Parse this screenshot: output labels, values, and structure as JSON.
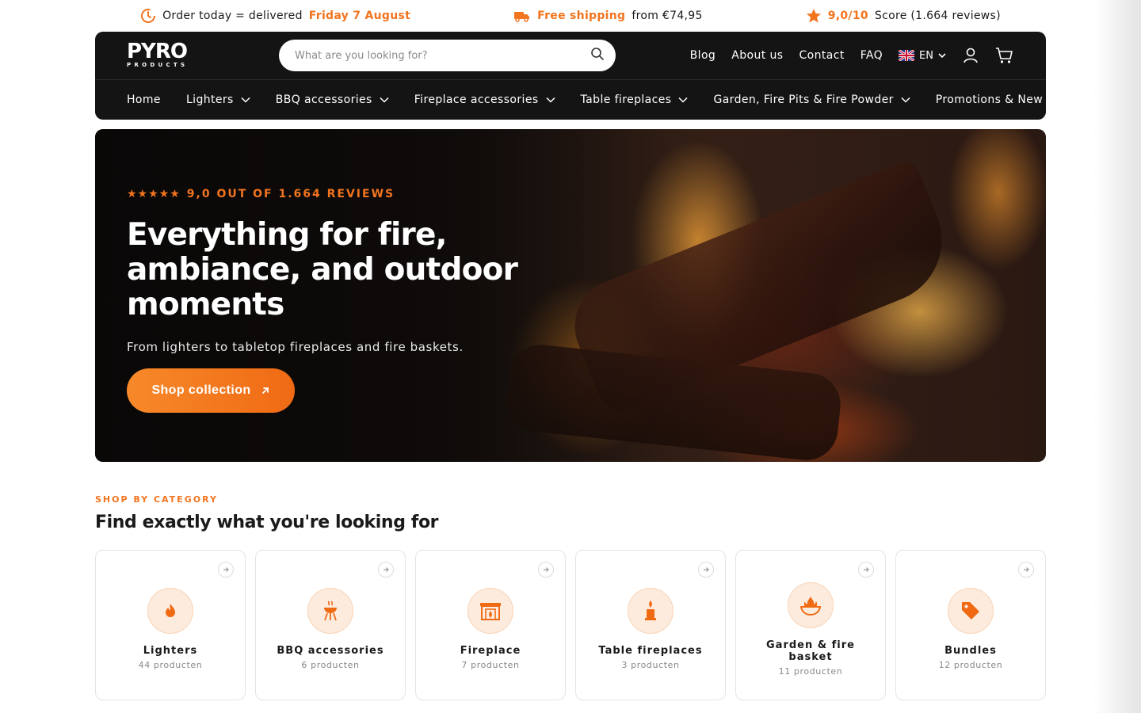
{
  "announcement": {
    "delivery_prefix": "Order today = delivered",
    "delivery_date": "Friday 7 August",
    "shipping_highlight": "Free shipping",
    "shipping_rest": "from €74,95",
    "score_highlight": "9,0/10",
    "score_rest": "Score (1.664 reviews)"
  },
  "header": {
    "logo_main": "PYRO",
    "logo_sub": "PRODUCTS",
    "search_placeholder": "What are you looking for?",
    "links": [
      "Blog",
      "About us",
      "Contact",
      "FAQ"
    ],
    "language": "EN",
    "nav": [
      {
        "label": "Home",
        "dropdown": false
      },
      {
        "label": "Lighters",
        "dropdown": true
      },
      {
        "label": "BBQ accessories",
        "dropdown": true
      },
      {
        "label": "Fireplace accessories",
        "dropdown": true
      },
      {
        "label": "Table fireplaces",
        "dropdown": true
      },
      {
        "label": "Garden, Fire Pits & Fire Powder",
        "dropdown": true
      },
      {
        "label": "Promotions & New Arrivals",
        "dropdown": false
      }
    ]
  },
  "hero": {
    "rating": "9,0 OUT OF 1.664 REVIEWS",
    "stars": "★★★★★",
    "title": "Everything for fire, ambiance, and outdoor moments",
    "subtitle": "From lighters to tabletop fireplaces and fire baskets.",
    "cta": "Shop collection"
  },
  "categories": {
    "eyebrow": "SHOP BY CATEGORY",
    "title": "Find exactly what you're looking for",
    "items": [
      {
        "name": "Lighters",
        "count": "44 producten",
        "icon": "flame-icon"
      },
      {
        "name": "BBQ accessories",
        "count": "6 producten",
        "icon": "grill-icon"
      },
      {
        "name": "Fireplace",
        "count": "7 producten",
        "icon": "fireplace-icon"
      },
      {
        "name": "Table fireplaces",
        "count": "3 producten",
        "icon": "candle-icon"
      },
      {
        "name": "Garden & fire basket",
        "count": "11 producten",
        "icon": "fire-bowl-icon"
      },
      {
        "name": "Bundles",
        "count": "12 producten",
        "icon": "tag-icon"
      }
    ]
  },
  "colors": {
    "accent": "#f2741f",
    "header_bg": "#141414",
    "icon_bg": "#fdebdd"
  }
}
